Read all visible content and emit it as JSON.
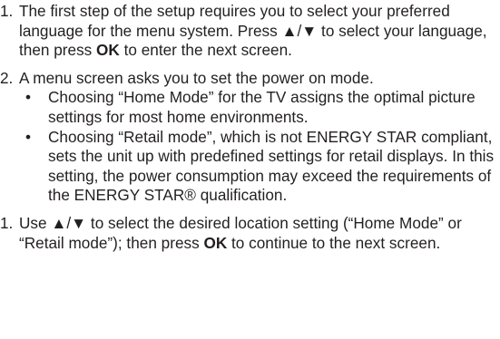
{
  "steps": [
    {
      "number": "1.",
      "before": "The first step of the setup requires you to select your preferred language for the menu system. Press ▲/▼ to select your language, then press ",
      "bold": "OK",
      "after": " to enter the next screen."
    },
    {
      "number": "2.",
      "text": "A menu screen asks you to set the power on mode.",
      "bullets": [
        {
          "marker": "•",
          "text": "Choosing “Home Mode” for the TV assigns the optimal picture settings for most home environments."
        },
        {
          "marker": "•",
          "text": "Choosing “Retail mode”, which is not ENERGY STAR compliant, sets the unit up with predefined settings for retail displays. In this setting, the power consumption may exceed the requirements of the ENERGY STAR® qualification."
        }
      ]
    },
    {
      "number": "1.",
      "before": "Use ▲/▼ to select the desired location setting (“Home Mode” or “Retail mode”); then press ",
      "bold": "OK",
      "after": " to continue to the next screen."
    }
  ]
}
